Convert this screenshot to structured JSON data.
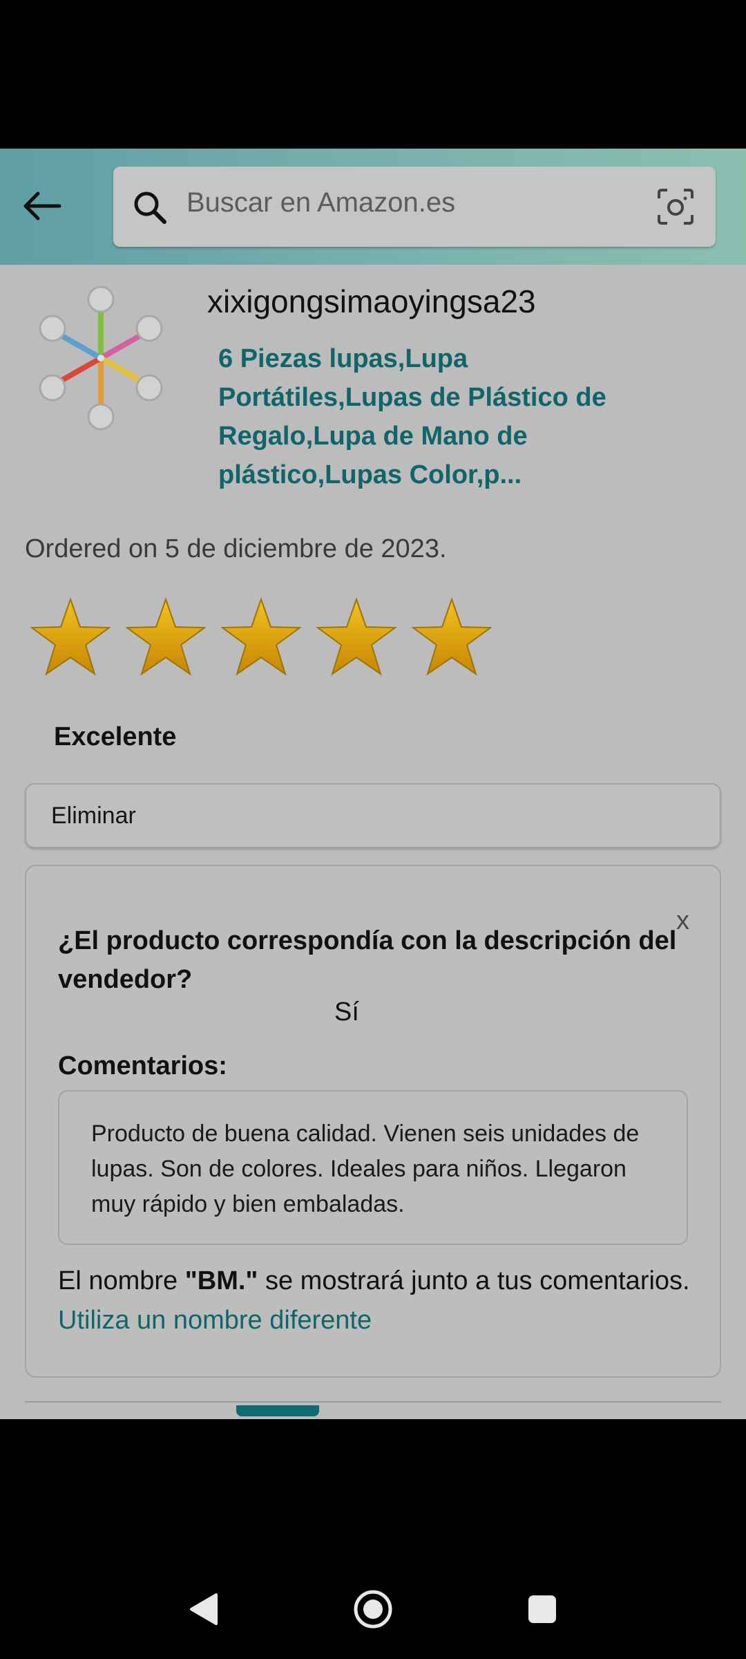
{
  "search": {
    "placeholder": "Buscar en Amazon.es"
  },
  "product": {
    "seller": "xixigongsimaoyingsa23",
    "title": "6 Piezas lupas,Lupa Portátiles,Lupas de Plástico de Regalo,Lupa de Mano de plástico,Lupas Color,p...",
    "ordered": "Ordered on 5 de diciembre de 2023."
  },
  "rating": {
    "stars": 5,
    "max": 5,
    "label": "Excelente"
  },
  "delete_button": "Eliminar",
  "feedback": {
    "close_label": "x",
    "question": "¿El producto correspondía con la descripción del vendedor?",
    "answer": "Sí",
    "comments_label": "Comentarios:",
    "comment": "Producto de buena calidad. Vienen seis unidades de lupas. Son de colores. Ideales para niños. Llegaron muy rápido y bien embaladas.",
    "name_prefix": "El nombre ",
    "name_value": "\"BM.\"",
    "name_suffix": " se mostrará junto a tus comentarios. ",
    "name_link": "Utiliza un nombre diferente"
  },
  "colors": {
    "accent": "#10656b",
    "star": "#e3a10a",
    "overlay_bg": "#bcbcbc"
  },
  "icons": {
    "back": "arrow-left-icon",
    "search": "search-icon",
    "camera": "camera-icon",
    "nav_back": "triangle-back-icon",
    "nav_home": "circle-home-icon",
    "nav_recent": "square-recent-icon"
  }
}
